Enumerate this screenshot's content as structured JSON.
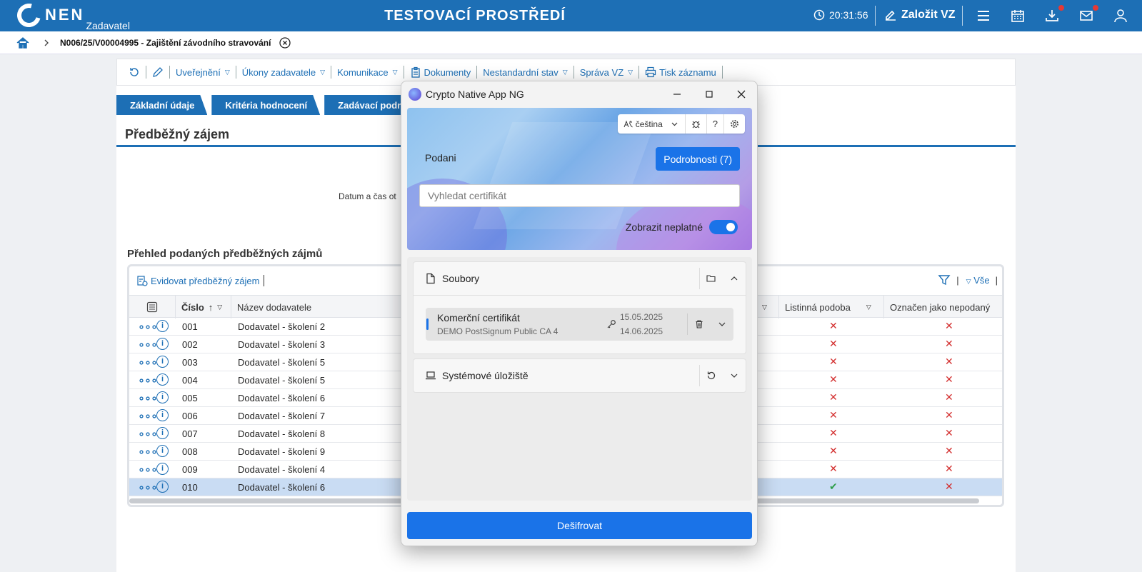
{
  "header": {
    "logo": "NEN",
    "logo_sub": "Zadavatel",
    "env_title": "TESTOVACÍ PROSTŘEDÍ",
    "time": "20:31:56",
    "new_vz": "Založit VZ"
  },
  "breadcrumb": {
    "text": "N006/25/V00004995 - Zajištění závodního stravování"
  },
  "toolbar": {
    "items": [
      "Uveřejnění",
      "Úkony zadavatele",
      "Komunikace",
      "Dokumenty",
      "Nestandardní stav",
      "Správa VZ",
      "Tisk záznamu"
    ]
  },
  "tabs": [
    "Základní údaje",
    "Kritéria hodnocení",
    "Zadávací podm"
  ],
  "section": {
    "title": "Předběžný zájem",
    "datum_label": "Datum a čas ot"
  },
  "overview": {
    "title": "Přehled podaných předběžných zájmů",
    "evidovat": "Evidovat předběžný zájem",
    "filter_all": "Vše",
    "columns": {
      "cislo": "Číslo",
      "nazev": "Název dodavatele",
      "listinna": "Listinná podoba",
      "oznacen": "Označen jako nepodaný"
    },
    "rows": [
      {
        "cislo": "001",
        "nazev": "Dodavatel - školení 2",
        "listinna": "✕",
        "oznacen": "✕"
      },
      {
        "cislo": "002",
        "nazev": "Dodavatel - školení 3",
        "listinna": "✕",
        "oznacen": "✕"
      },
      {
        "cislo": "003",
        "nazev": "Dodavatel - školení 5",
        "listinna": "✕",
        "oznacen": "✕"
      },
      {
        "cislo": "004",
        "nazev": "Dodavatel - školení 5",
        "listinna": "✕",
        "oznacen": "✕"
      },
      {
        "cislo": "005",
        "nazev": "Dodavatel - školení 6",
        "listinna": "✕",
        "oznacen": "✕"
      },
      {
        "cislo": "006",
        "nazev": "Dodavatel - školení 7",
        "listinna": "✕",
        "oznacen": "✕"
      },
      {
        "cislo": "007",
        "nazev": "Dodavatel - školení 8",
        "listinna": "✕",
        "oznacen": "✕"
      },
      {
        "cislo": "008",
        "nazev": "Dodavatel - školení 9",
        "listinna": "✕",
        "oznacen": "✕"
      },
      {
        "cislo": "009",
        "nazev": "Dodavatel - školení 4",
        "listinna": "✕",
        "oznacen": "✕"
      },
      {
        "cislo": "010",
        "nazev": "Dodavatel - školení 6",
        "listinna": "✔",
        "oznacen": "✕"
      }
    ]
  },
  "dialog": {
    "title": "Crypto Native App NG",
    "language": "čeština",
    "podani": "Podani",
    "details_button": "Podrobnosti (7)",
    "search_placeholder": "Vyhledat certifikát",
    "toggle_label": "Zobrazit neplatné",
    "files_section": "Soubory",
    "cert_name": "Komerční certifikát",
    "cert_issuer": "DEMO PostSignum Public CA 4",
    "cert_from": "15.05.2025",
    "cert_to": "14.06.2025",
    "system_store": "Systémové úložiště",
    "decrypt_button": "Dešifrovat"
  },
  "colors": {
    "brand": "#1d6fb5",
    "dialog_accent": "#1a73e8",
    "error": "#d32f2f",
    "success": "#2e9e4a"
  }
}
